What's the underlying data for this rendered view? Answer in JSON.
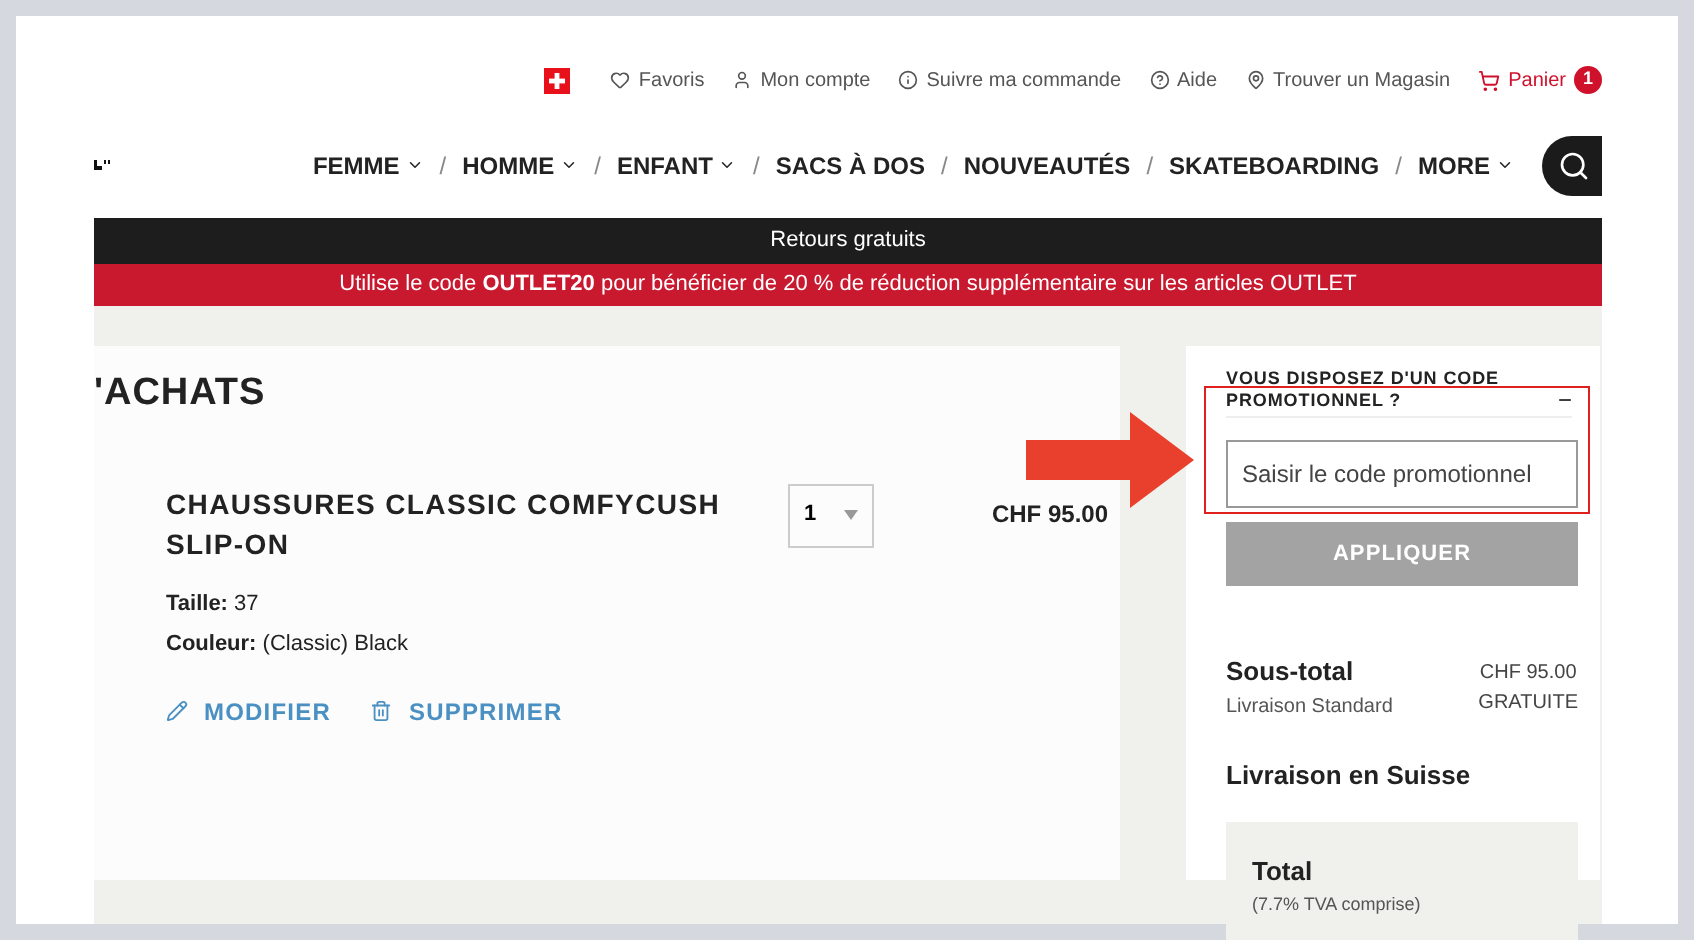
{
  "utility_links": [
    {
      "kind": "favorites",
      "label": "Favoris"
    },
    {
      "kind": "account",
      "label": "Mon compte"
    },
    {
      "kind": "track",
      "label": "Suivre ma commande"
    },
    {
      "kind": "help",
      "label": "Aide"
    },
    {
      "kind": "store",
      "label": "Trouver un Magasin"
    }
  ],
  "cart": {
    "label": "Panier",
    "count": "1"
  },
  "nav": [
    {
      "label": "FEMME",
      "dropdown": true
    },
    {
      "label": "HOMME",
      "dropdown": true
    },
    {
      "label": "ENFANT",
      "dropdown": true
    },
    {
      "label": "SACS À DOS",
      "dropdown": false
    },
    {
      "label": "NOUVEAUTÉS",
      "dropdown": false
    },
    {
      "label": "SKATEBOARDING",
      "dropdown": false
    },
    {
      "label": "MORE",
      "dropdown": true
    }
  ],
  "nav_separator": "/",
  "banner": "Retours gratuits",
  "promo_banner": "Utilise le code **OUTLET20** pour bénéficier de 20 % de réduction supplémentaire sur les articles OUTLET",
  "page_title": "'ACHATS",
  "item": {
    "name": "CHAUSSURES CLASSIC COMFYCUSH SLIP-ON",
    "quantity": "1",
    "price": "CHF 95.00",
    "attributes": [
      {
        "label": "Taille:",
        "value": "37"
      },
      {
        "label": "Couleur:",
        "value": "(Classic) Black"
      }
    ],
    "actions": [
      {
        "kind": "edit",
        "label": "MODIFIER"
      },
      {
        "kind": "delete",
        "label": "SUPPRIMER"
      }
    ]
  },
  "promo": {
    "heading": "VOUS DISPOSEZ D'UN CODE PROMOTIONNEL ?",
    "collapse": "−",
    "expanded": true,
    "placeholder": "Saisir le code promotionnel",
    "button": "APPLIQUER",
    "highlighted": true
  },
  "summary": {
    "subtotal_label": "Sous-total",
    "subtotal_value": "CHF 95.00",
    "shipping_label": "Livraison Standard",
    "shipping_value": "GRATUITE",
    "shipping_region": "Livraison en Suisse",
    "total_label": "Total",
    "total_note": "(7.7% TVA comprise)"
  }
}
